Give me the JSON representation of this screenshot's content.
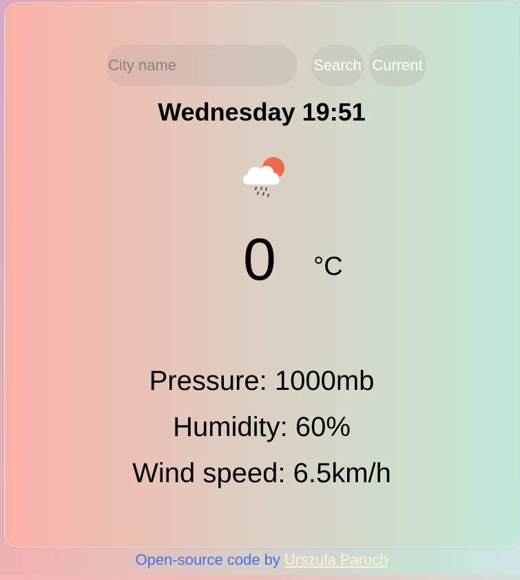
{
  "search": {
    "placeholder": "City name",
    "search_label": "Search",
    "current_label": "Current"
  },
  "weather": {
    "datetime": "Wednesday 19:51",
    "icon": "cloud-sun-rain-icon",
    "temperature": "0",
    "unit": "°C",
    "pressure": "Pressure: 1000mb",
    "humidity": "Humidity: 60%",
    "wind": "Wind speed: 6.5km/h"
  },
  "footer": {
    "text": "Open-source code by",
    "author_link": "Urszula Paruch"
  },
  "colors": {
    "accent_link": "#3d73ea",
    "author_link": "#fff4d6",
    "sun": "#f06a4a"
  }
}
